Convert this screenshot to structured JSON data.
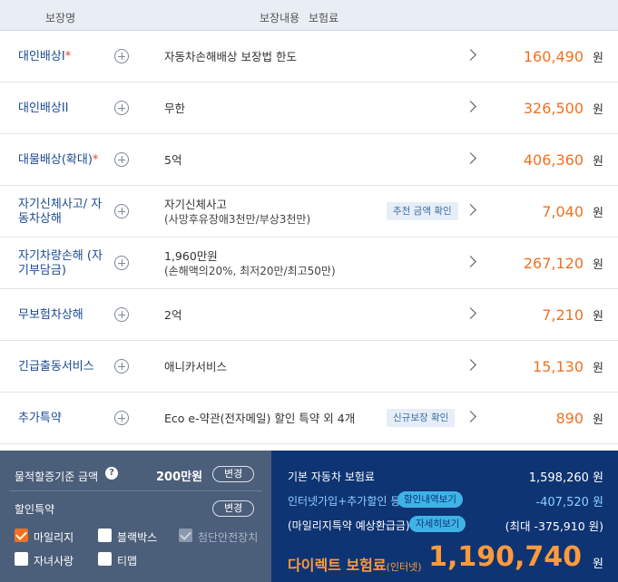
{
  "header": {
    "col1": "보장명",
    "col2": "보장내용",
    "col3": "보험료"
  },
  "rows": [
    {
      "name": "대인배상I",
      "required": "*",
      "desc": "자동차손해배상 보장법 한도",
      "sub": "",
      "tag": "",
      "price": "160,490",
      "unit": "원"
    },
    {
      "name": "대인배상II",
      "required": "",
      "desc": "무한",
      "sub": "",
      "tag": "",
      "price": "326,500",
      "unit": "원"
    },
    {
      "name": "대물배상(확대)",
      "required": "*",
      "desc": "5억",
      "sub": "",
      "tag": "",
      "price": "406,360",
      "unit": "원"
    },
    {
      "name": "자기신체사고/ 자동차상해",
      "required": "",
      "desc": "자기신체사고",
      "sub": "(사망후유장애3천만/부상3천만)",
      "tag": "추천 금액 확인",
      "price": "7,040",
      "unit": "원"
    },
    {
      "name": "자기차량손해 (자기부담금)",
      "required": "",
      "desc": "1,960만원",
      "sub": "(손해액의20%, 최저20만/최고50만)",
      "tag": "",
      "price": "267,120",
      "unit": "원"
    },
    {
      "name": "무보험차상해",
      "required": "",
      "desc": "2억",
      "sub": "",
      "tag": "",
      "price": "7,210",
      "unit": "원"
    },
    {
      "name": "긴급출동서비스",
      "required": "",
      "desc": "애니카서비스",
      "sub": "",
      "tag": "",
      "price": "15,130",
      "unit": "원"
    },
    {
      "name": "추가특약",
      "required": "",
      "desc": "Eco e-약관(전자메일) 할인 특약 외 4개",
      "sub": "",
      "tag": "신규보장 확인",
      "price": "890",
      "unit": "원"
    }
  ],
  "left_panel": {
    "property_label": "물적할증기준 금액",
    "help_icon": "question-icon",
    "property_value": "200만원",
    "change_label": "변경",
    "discount_label": "할인특약",
    "checkboxes": [
      {
        "label": "마일리지",
        "state": "checked"
      },
      {
        "label": "블랙박스",
        "state": "unchecked"
      },
      {
        "label": "첨단안전장치",
        "state": "disabled"
      },
      {
        "label": "자녀사랑",
        "state": "unchecked"
      },
      {
        "label": "티맵",
        "state": "unchecked"
      }
    ]
  },
  "right_panel": {
    "base_label": "기본 자동차 보험료",
    "base_value": "1,598,260 원",
    "discount_label": "인터넷가입+추가할인 등",
    "discount_button": "할인내역보기",
    "discount_value": "-407,520 원",
    "mileage_label": "(마일리지특약 예상환급금)",
    "mileage_button": "자세히보기",
    "mileage_value": "(최대 -375,910 원)",
    "total_label": "다이렉트 보험료",
    "total_label_small": "(인터넷)",
    "total_value": "1,190,740",
    "total_unit": "원"
  }
}
